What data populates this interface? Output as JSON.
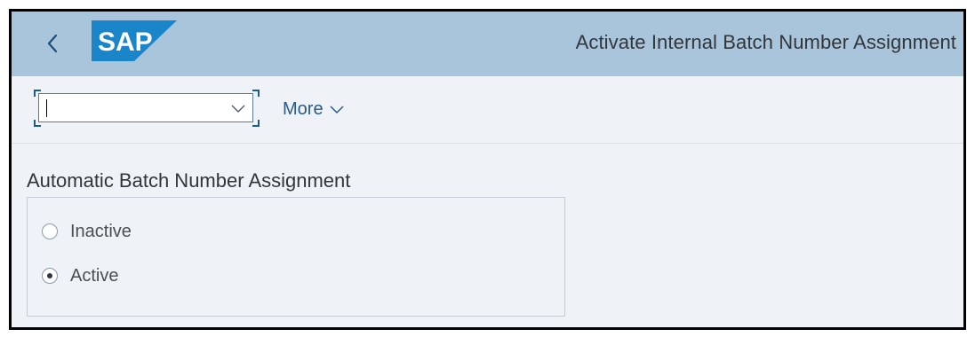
{
  "shell": {
    "title": "Activate Internal Batch Number Assignment",
    "logo_text": "SAP",
    "colors": {
      "header_bg": "#a9c5dc",
      "logo_blue": "#1b85c9",
      "page_bg": "#eff3f7"
    }
  },
  "toolbar": {
    "okcode_value": "",
    "more_label": "More"
  },
  "group": {
    "title": "Automatic Batch Number Assignment",
    "options": [
      {
        "label": "Inactive",
        "checked": false
      },
      {
        "label": "Active",
        "checked": true
      }
    ]
  },
  "icons": {
    "back": "chevron-left-icon",
    "dropdown": "chevron-down-icon",
    "more": "chevron-down-icon"
  }
}
